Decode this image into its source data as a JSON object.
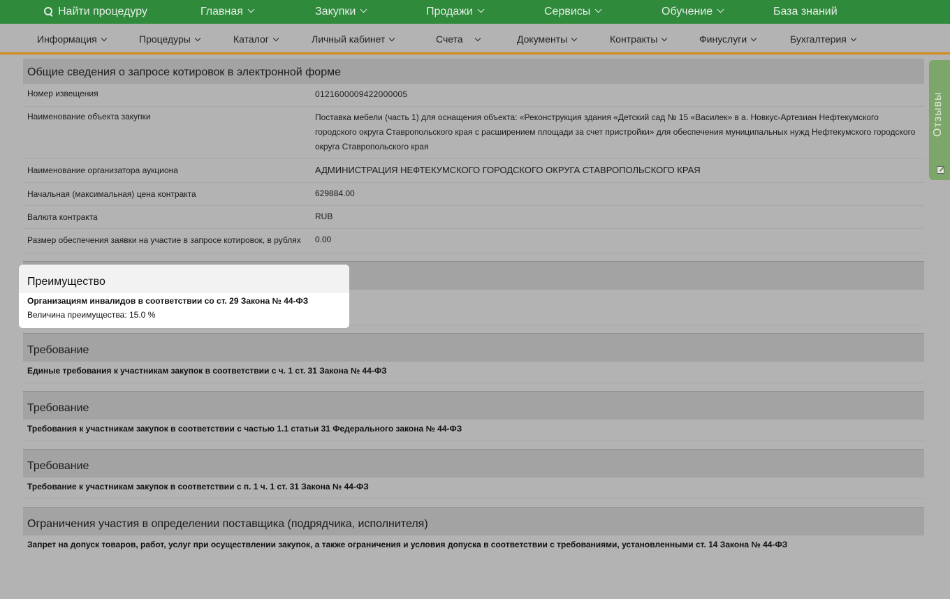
{
  "topnav": {
    "search_label": "Найти процедуру",
    "items": [
      "Главная",
      "Закупки",
      "Продажи",
      "Сервисы",
      "Обучение",
      "База знаний"
    ]
  },
  "subnav": {
    "items": [
      "Информация",
      "Процедуры",
      "Каталог",
      "Личный кабинет",
      "Счета",
      "Документы",
      "Контракты",
      "Финуслуги",
      "Бухгалтерия"
    ]
  },
  "general": {
    "title": "Общие сведения о запросе котировок в электронной форме",
    "rows": [
      {
        "label": "Номер извещения",
        "value": "0121600009422000005"
      },
      {
        "label": "Наименование объекта закупки",
        "value": "Поставка мебели (часть 1) для оснащения объекта: «Реконструкция здания «Детский сад № 15 «Василек» в а. Новкус-Артезиан Нефтекумского городского округа Ставропольского края с расширением площади за счет пристройки» для обеспечения муниципальных нужд Нефтекумского городского округа Ставропольского края"
      },
      {
        "label": "Наименование организатора аукциона",
        "value": "АДМИНИСТРАЦИЯ НЕФТЕКУМСКОГО ГОРОДСКОГО ОКРУГА СТАВРОПОЛЬСКОГО КРАЯ"
      },
      {
        "label": "Начальная (максимальная) цена контракта",
        "value": "629884.00"
      },
      {
        "label": "Валюта контракта",
        "value": "RUB"
      },
      {
        "label": "Размер обеспечения заявки на участие в запросе котировок, в рублях",
        "value": "0.00"
      }
    ]
  },
  "advantage": {
    "title": "Преимущество",
    "line1": "Организациям инвалидов в соответствии со ст. 29 Закона № 44-ФЗ",
    "line2": "Величина преимущества: 15.0 %"
  },
  "requirements": [
    {
      "title": "Требование",
      "text": "Единые требования к участникам закупок в соответствии с ч. 1 ст. 31 Закона № 44-ФЗ"
    },
    {
      "title": "Требование",
      "text": "Требования к участникам закупок в соответствии с частью 1.1 статьи 31 Федерального закона № 44-ФЗ"
    },
    {
      "title": "Требование",
      "text": "Требование к участникам закупок в соответствии с п. 1 ч. 1 ст. 31 Закона № 44-ФЗ"
    }
  ],
  "restrictions": {
    "title": "Ограничения участия в определении поставщика (подрядчика, исполнителя)",
    "text": "Запрет на допуск товаров, работ, услуг при осуществлении закупок, а также ограничения и условия допуска в соответствии с требованиями, установленными ст. 14 Закона № 44-ФЗ"
  },
  "sidetab": {
    "label": "Отзывы"
  }
}
